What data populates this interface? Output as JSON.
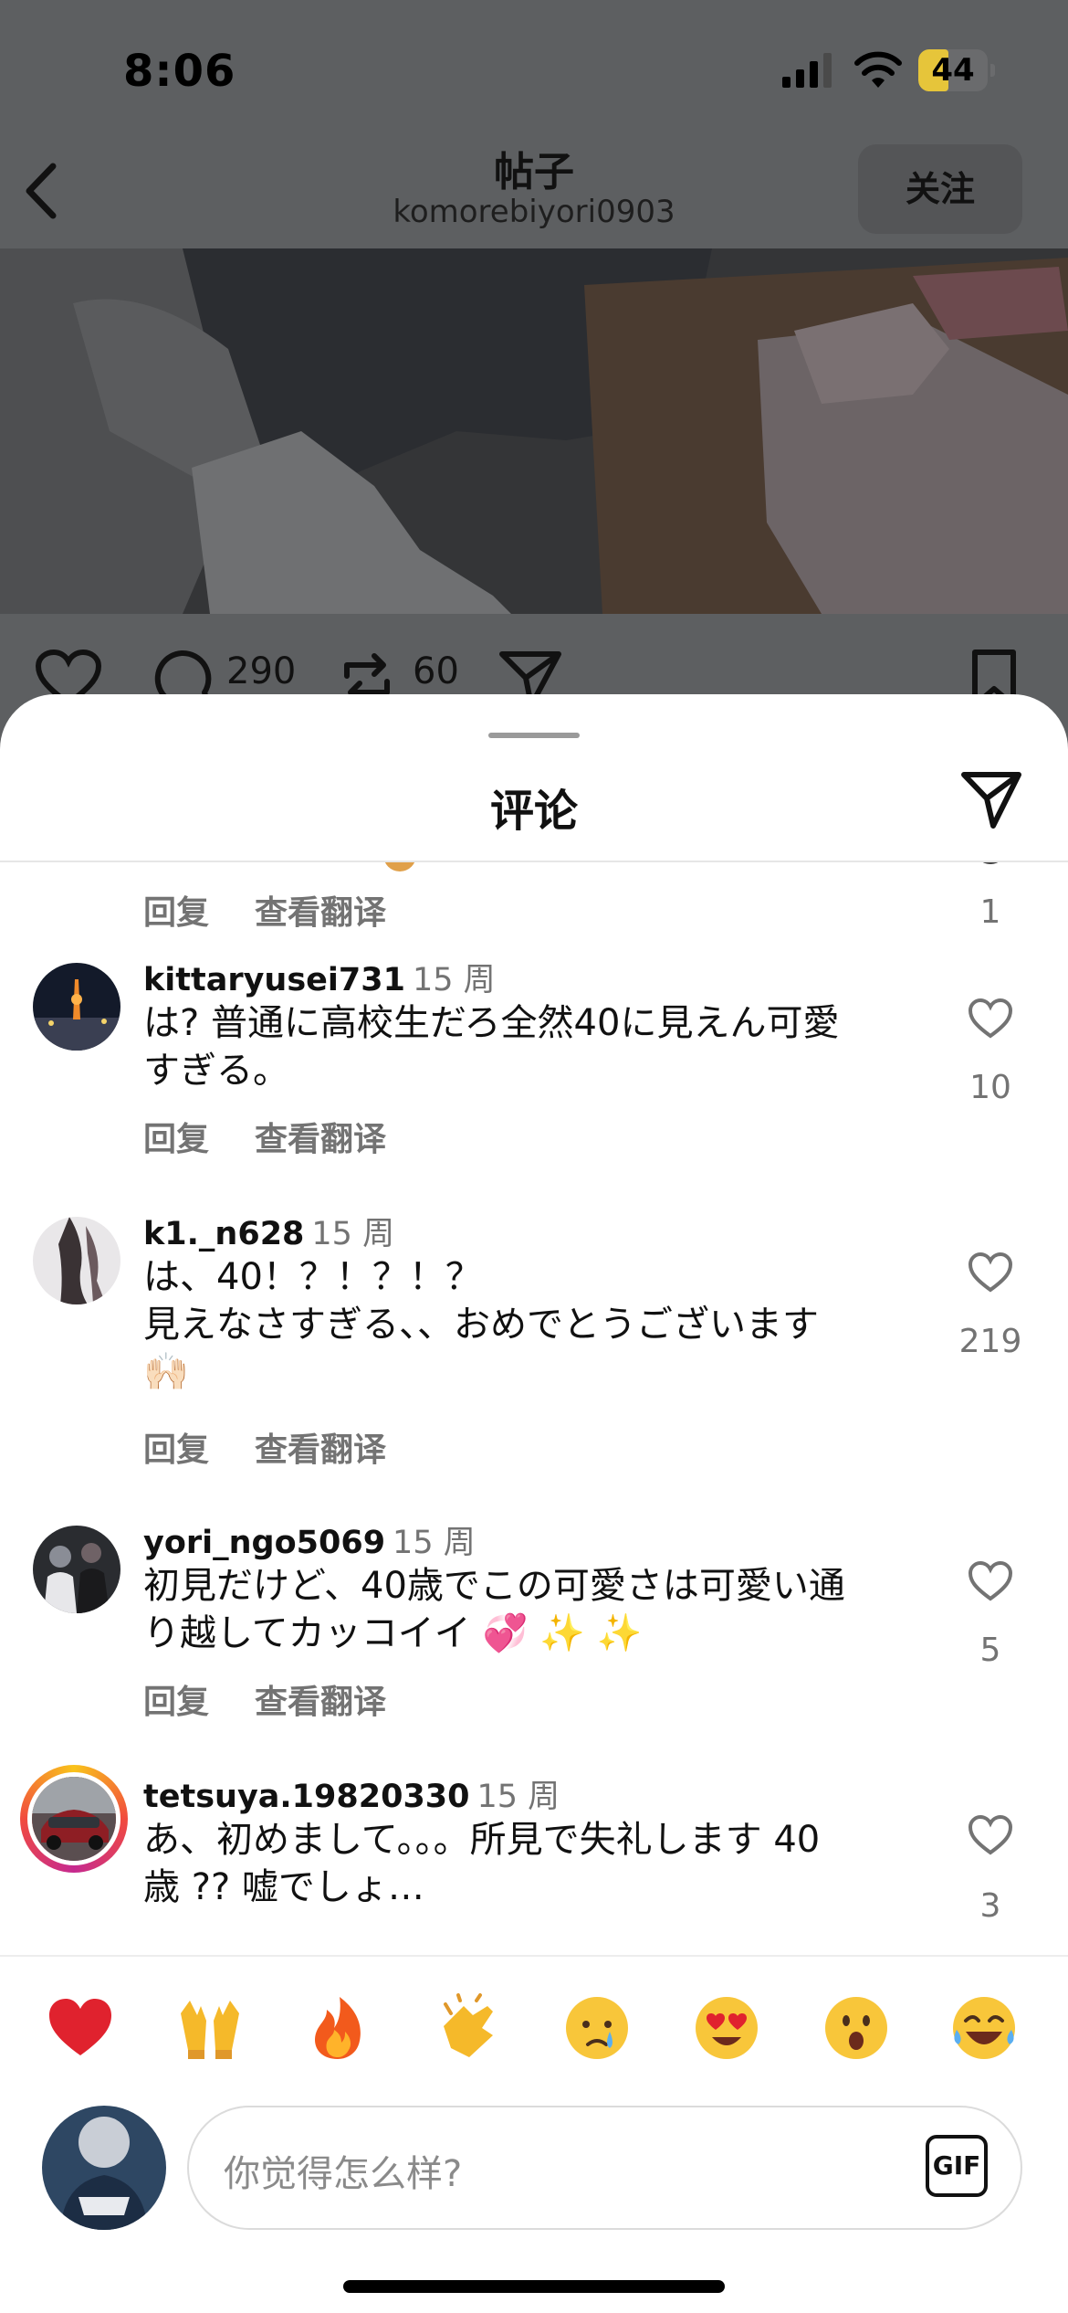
{
  "status_bar": {
    "time": "8:06",
    "battery": "44",
    "battery_level": 0.44
  },
  "header": {
    "title": "帖子",
    "username": "komorebiyori0903",
    "follow_label": "关注"
  },
  "post_actions": {
    "comments_count": "290",
    "reposts_count": "60"
  },
  "sheet": {
    "title": "评论"
  },
  "partial_comment": {
    "reply_label": "回复",
    "translate_label": "查看翻译",
    "likes": "1"
  },
  "comments": [
    {
      "username": "kittaryusei731",
      "time": "15 周",
      "text": "は? 普通に高校生だろ全然40に見えん可愛\nすぎる。",
      "likes": "10",
      "reply_label": "回复",
      "translate_label": "查看翻译"
    },
    {
      "username": "k1._n628",
      "time": "15 周",
      "text": "は、40！？！？！？\n見えなさすぎる、、おめでとうございます\n🙌🏻",
      "likes": "219",
      "reply_label": "回复",
      "translate_label": "查看翻译"
    },
    {
      "username": "yori_ngo5069",
      "time": "15 周",
      "text": "初見だけど、40歳でこの可愛さは可愛い通\nり越してカッコイイ 💞 ✨ ✨",
      "likes": "5",
      "reply_label": "回复",
      "translate_label": "查看翻译"
    },
    {
      "username": "tetsuya.19820330",
      "time": "15 周",
      "text": "あ、初めまして。。。所見で失礼します 40\n歳 ?? 嘘でしょ…",
      "likes": "3"
    }
  ],
  "emoji_bar": [
    "heart",
    "raised-hands",
    "fire",
    "clapping",
    "crying",
    "heart-eyes",
    "surprised",
    "laughing"
  ],
  "input": {
    "placeholder": "你觉得怎么样?",
    "gif_label": "GIF"
  },
  "colors": {
    "text_primary": "#111111",
    "text_secondary": "#737373",
    "battery": "#e6c53a",
    "overlay": "#5d5f61"
  }
}
